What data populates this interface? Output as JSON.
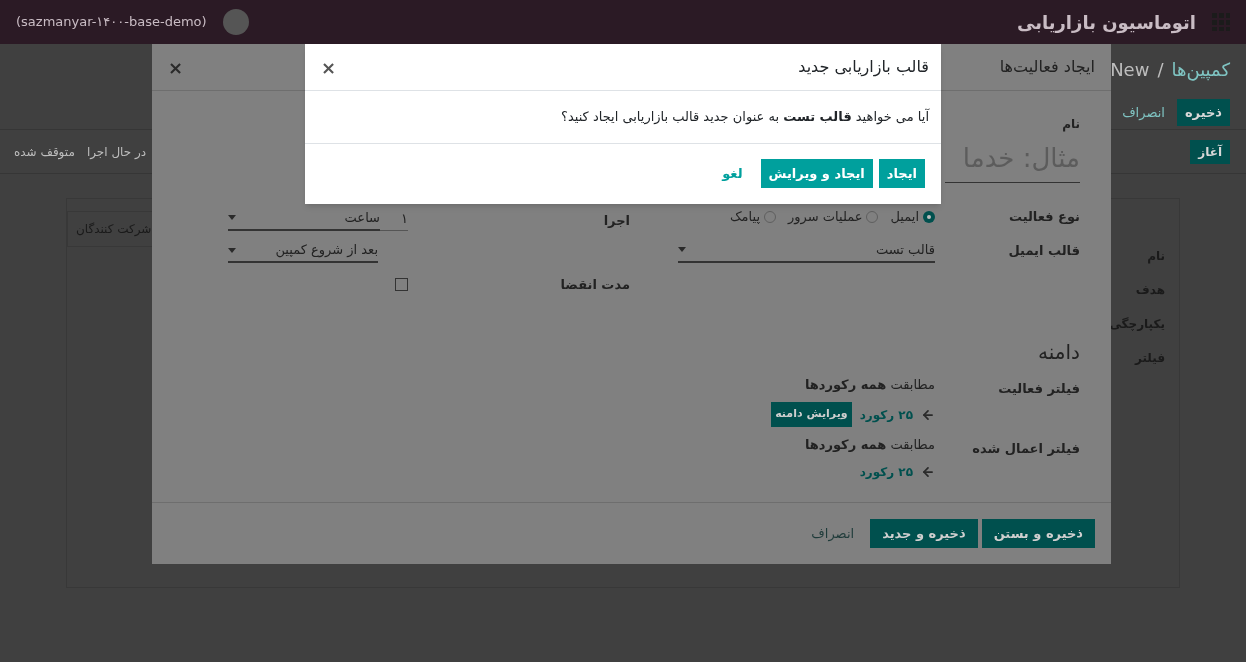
{
  "topbar": {
    "app_title": "اتوماسیون بازاریابی",
    "database": "(sazmanyar-۱۴۰۰-base-demo)"
  },
  "breadcrumb": {
    "parent": "کمپین‌ها",
    "separator": "/",
    "current": "New"
  },
  "page_buttons": [
    {
      "label": "ذخیره",
      "kind": "primary"
    },
    {
      "label": "انصراف",
      "kind": "link"
    }
  ],
  "status_bar": {
    "button": "آغاز",
    "stages": [
      {
        "label": "در حال اجرا",
        "selected": false
      },
      {
        "label": "متوقف شده",
        "selected": false
      }
    ]
  },
  "sheet": {
    "fields": [
      "نام",
      "هدف",
      "یکپارچگی",
      "فیلتر"
    ],
    "tab": "شرکت کنندگان"
  },
  "activity_dialog": {
    "title": "ایجاد فعالیت‌ها",
    "close": "×",
    "name_label": "نام",
    "name_placeholder": "مثال: خدما",
    "activity_type": {
      "label": "نوع فعالیت",
      "options": [
        {
          "label": "ایمیل",
          "selected": true
        },
        {
          "label": "عملیات سرور",
          "selected": false
        },
        {
          "label": "پیامک",
          "selected": false
        }
      ]
    },
    "email_template": {
      "label": "قالب ایمیل",
      "value": "قالب تست"
    },
    "trigger": {
      "label": "اجرا",
      "interval": "۱",
      "unit": "ساعت",
      "when": "بعد از شروع کمپین"
    },
    "expiry": {
      "label": "مدت انقضا",
      "checked": false
    },
    "domain": {
      "title": "دامنه",
      "filters": [
        {
          "label": "فیلتر فعالیت",
          "match": "مطابقت **همه رکوردها**",
          "records": "۲۵ رکورد",
          "edit_button": "ویرایش دامنه"
        },
        {
          "label": "فیلتر اعمال شده",
          "match": "مطابقت **همه رکوردها**",
          "records": "۲۵ رکورد"
        }
      ]
    },
    "footer_buttons": [
      {
        "label": "ذخیره و بستن",
        "kind": "primary"
      },
      {
        "label": "ذخیره و جدید",
        "kind": "primary"
      },
      {
        "label": "انصراف",
        "kind": "link"
      }
    ]
  },
  "confirm_dialog": {
    "title": "قالب بازاریابی جدید",
    "close": "×",
    "message": "آیا می خواهید **قالب تست** به عنوان جدید قالب بازاریابی ایجاد کنید؟",
    "buttons": [
      {
        "label": "ایجاد",
        "kind": "primary"
      },
      {
        "label": "ایجاد و ویرایش",
        "kind": "primary"
      },
      {
        "label": "لغو",
        "kind": "link"
      }
    ]
  }
}
